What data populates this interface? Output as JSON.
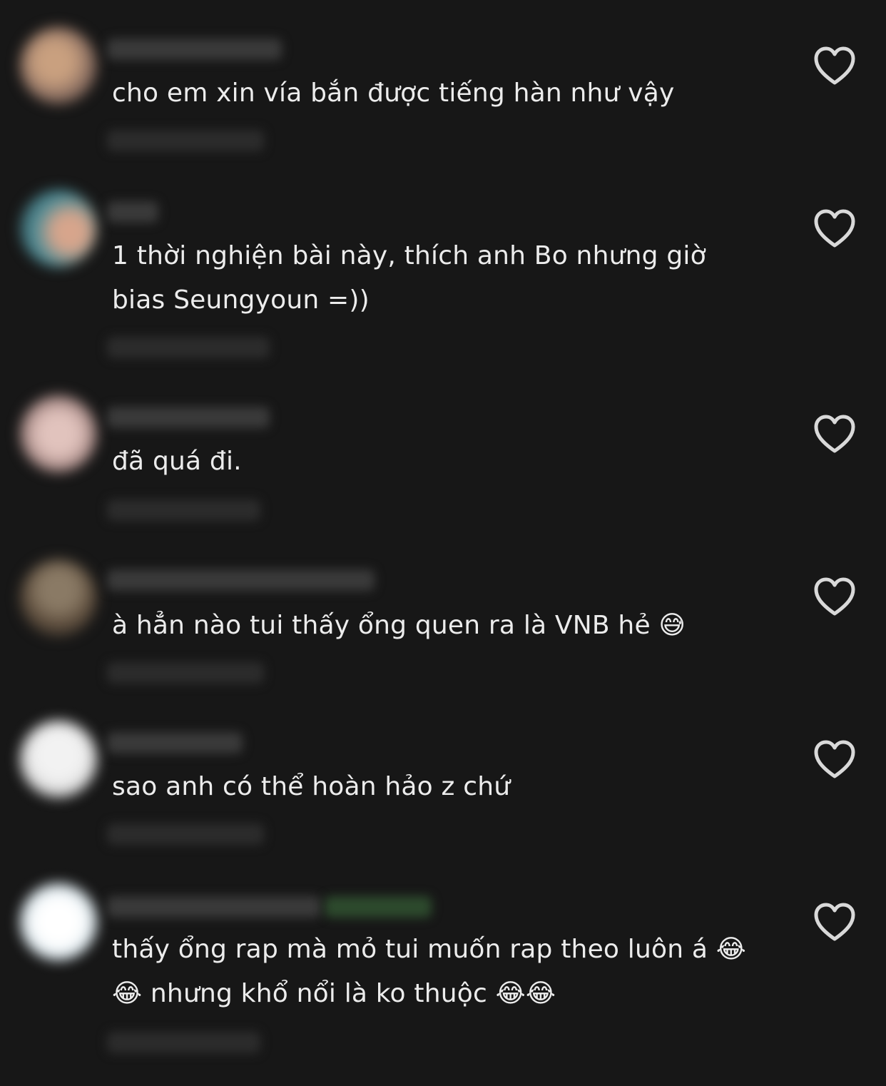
{
  "comments": [
    {
      "text": "cho em xin vía bắn được tiếng hàn như vậy",
      "avatar_colors": [
        "#8b6f62",
        "#c9a07f"
      ]
    },
    {
      "text": "1 thời nghiện bài này, thích anh Bo nhưng giờ bias Seungyoun =))",
      "avatar_colors": [
        "#4e8c96",
        "#d7a58c"
      ]
    },
    {
      "text": "đã quá đi.",
      "avatar_colors": [
        "#a78a86",
        "#e1c3bd"
      ]
    },
    {
      "text": "à hẳn nào tui thấy ổng quen ra là VNB hẻ 😅",
      "avatar_colors": [
        "#5a4a3a",
        "#8a7a65"
      ]
    },
    {
      "text": "sao anh có thể hoàn hảo z chứ",
      "avatar_colors": [
        "#d8d8d8",
        "#f2f2f2"
      ]
    },
    {
      "text": "thấy ổng rap mà mỏ tui muốn rap theo luôn á 😂😂 nhưng khổ nổi là ko thuộc 😂😂",
      "avatar_colors": [
        "#dce8ee",
        "#ffffff"
      ]
    }
  ],
  "icons": {
    "like": "heart-outline-icon"
  },
  "colors": {
    "background": "#171717",
    "text": "#ececec",
    "icon": "#d9d9d9"
  }
}
